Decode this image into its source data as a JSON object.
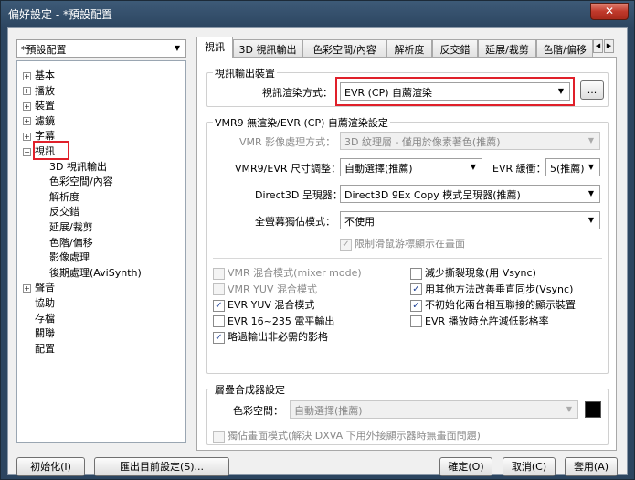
{
  "window": {
    "title": "偏好設定 - *預設配置",
    "close_label": "✕"
  },
  "profile_combo": {
    "value": "*預設配置"
  },
  "tree": {
    "items": [
      {
        "label": "基本",
        "expander": "+"
      },
      {
        "label": "播放",
        "expander": "+"
      },
      {
        "label": "裝置",
        "expander": "+"
      },
      {
        "label": "濾鏡",
        "expander": "+"
      },
      {
        "label": "字幕",
        "expander": "+"
      },
      {
        "label": "視訊",
        "expander": "−"
      },
      {
        "label": "3D 視訊輸出"
      },
      {
        "label": "色彩空間/內容"
      },
      {
        "label": "解析度"
      },
      {
        "label": "反交錯"
      },
      {
        "label": "延展/裁剪"
      },
      {
        "label": "色階/偏移"
      },
      {
        "label": "影像處理"
      },
      {
        "label": "後期處理(AviSynth)"
      },
      {
        "label": "聲音",
        "expander": "+"
      },
      {
        "label": "協助"
      },
      {
        "label": "存檔"
      },
      {
        "label": "關聯"
      },
      {
        "label": "配置"
      }
    ]
  },
  "tabs": [
    {
      "label": "視訊"
    },
    {
      "label": "3D 視訊輸出"
    },
    {
      "label": "色彩空間/內容"
    },
    {
      "label": "解析度"
    },
    {
      "label": "反交錯"
    },
    {
      "label": "延展/裁剪"
    },
    {
      "label": "色階/偏移"
    }
  ],
  "tab_scroll": {
    "left": "◀",
    "right": "▶"
  },
  "output_group": {
    "title": "視訊輸出裝置",
    "renderer_label": "視訊渲染方式：",
    "renderer_value": "EVR (CP) 自薦渲染",
    "more_button": "..."
  },
  "vmr9_group": {
    "title": "VMR9 無渲染/EVR (CP) 自薦渲染設定",
    "vmr_mode_label": "VMR 影像處理方式：",
    "vmr_mode_value": "3D 紋理層 - 僅用於像素著色(推薦)",
    "resize_label": "VMR9/EVR 尺寸調整：",
    "resize_value": "自動選擇(推薦)",
    "evr_buffer_label": "EVR 緩衝：",
    "evr_buffer_value": "5(推薦)",
    "d3d_label": "Direct3D 呈現器：",
    "d3d_value": "Direct3D 9Ex Copy 模式呈現器(推薦)",
    "fullscreen_label": "全螢幕獨佔模式：",
    "fullscreen_value": "不使用",
    "limit_mouse_label": "限制滑鼠游標顯示在畫面",
    "left_checks": [
      {
        "label": "VMR 混合模式(mixer mode)",
        "checked": false,
        "enabled": false
      },
      {
        "label": "VMR YUV 混合模式",
        "checked": false,
        "enabled": false
      },
      {
        "label": "EVR YUV 混合模式",
        "checked": true,
        "enabled": true
      },
      {
        "label": "EVR 16~235 電平輸出",
        "checked": false,
        "enabled": true
      },
      {
        "label": "略過輸出非必需的影格",
        "checked": true,
        "enabled": true
      }
    ],
    "right_checks": [
      {
        "label": "減少撕裂現象(用 Vsync)",
        "checked": false,
        "enabled": true
      },
      {
        "label": "用其他方法改善垂直同步(Vsync)",
        "checked": true,
        "enabled": true
      },
      {
        "label": "不初始化兩台相互聯接的顯示裝置",
        "checked": true,
        "enabled": true
      },
      {
        "label": "EVR 播放時允許減低影格率",
        "checked": false,
        "enabled": true
      }
    ]
  },
  "overlay_group": {
    "title": "層疊合成器設定",
    "colorspace_label": "色彩空間：",
    "colorspace_value": "自動選擇(推薦)",
    "exclusive_label": "獨佔畫面模式(解決 DXVA 下用外接顯示器時無畫面問題)"
  },
  "footer": {
    "init_button": "初始化(I)",
    "export_button": "匯出目前設定(S)...",
    "ok_button": "確定(O)",
    "cancel_button": "取消(C)",
    "apply_button": "套用(A)"
  },
  "colors": {
    "highlight": "#e0202a",
    "checkmark": "#1c3f94",
    "swatch": "#000000"
  }
}
